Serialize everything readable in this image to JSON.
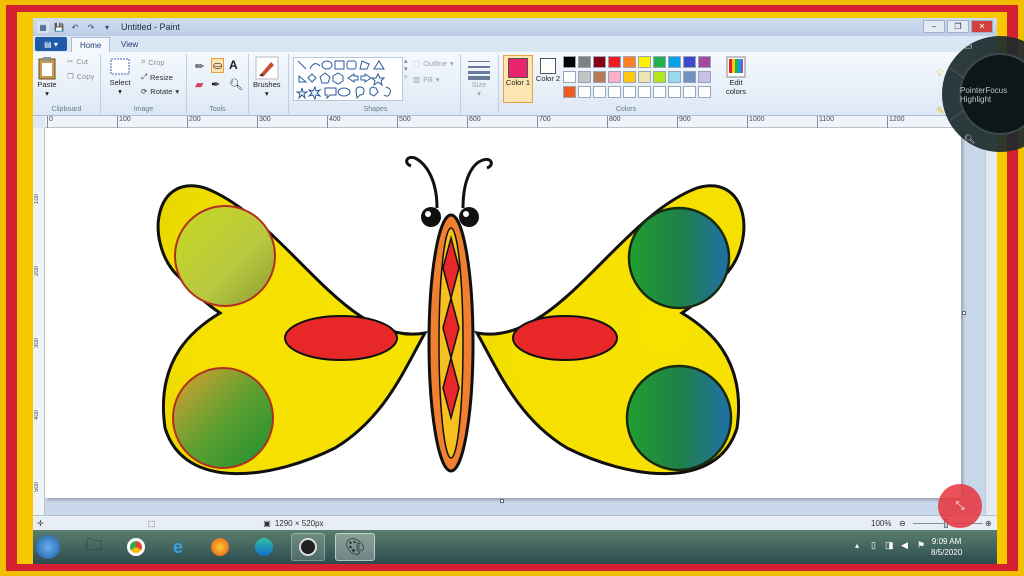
{
  "window": {
    "title": "Untitled - Paint",
    "controls": [
      "–",
      "❐",
      "✕"
    ]
  },
  "tabs": {
    "file": "▤ ▾",
    "home": "Home",
    "view": "View"
  },
  "ribbon": {
    "clipboard": {
      "paste": "Paste",
      "cut": "Cut",
      "copy": "Copy",
      "label": "Clipboard"
    },
    "image": {
      "select": "Select",
      "crop": "Crop",
      "resize": "Resize",
      "rotate": "Rotate",
      "label": "Image"
    },
    "tools": {
      "label": "Tools"
    },
    "brushes": {
      "label": "Brushes"
    },
    "shapes": {
      "outline": "Outline",
      "fill": "Fill",
      "label": "Shapes"
    },
    "size": {
      "label": "Size"
    },
    "colors": {
      "color1": "Color 1",
      "color2": "Color 2",
      "edit": "Edit colors",
      "label": "Colors",
      "color1_value": "#e8246a",
      "color2_value": "#ffffff",
      "palette_row1": [
        "#000000",
        "#7f7f7f",
        "#880015",
        "#ed1c24",
        "#ff7f27",
        "#fff200",
        "#22b14c",
        "#00a2e8",
        "#3f48cc",
        "#a349a4"
      ],
      "palette_row2": [
        "#ffffff",
        "#c3c3c3",
        "#b97a57",
        "#ffaec9",
        "#ffc90e",
        "#efe4b0",
        "#b5e61d",
        "#99d9ea",
        "#7092be",
        "#c8bfe7"
      ],
      "palette_row3": [
        "#ed5a24",
        "#ffffff",
        "#ffffff",
        "#ffffff",
        "#ffffff",
        "#ffffff",
        "#ffffff",
        "#ffffff",
        "#ffffff",
        "#ffffff"
      ]
    }
  },
  "ruler": {
    "h_ticks": [
      "0",
      "100",
      "200",
      "300",
      "400",
      "500",
      "600",
      "700",
      "800",
      "900",
      "1000",
      "1100",
      "1200"
    ],
    "v_ticks": [
      "100",
      "200",
      "300",
      "400",
      "500"
    ]
  },
  "status": {
    "canvas_size": "1290 × 520px",
    "zoom": "100%"
  },
  "overlay": {
    "text": "PointerFocus Highlight"
  },
  "taskbar": {
    "time": "9:09 AM",
    "date": "8/5/2020"
  }
}
